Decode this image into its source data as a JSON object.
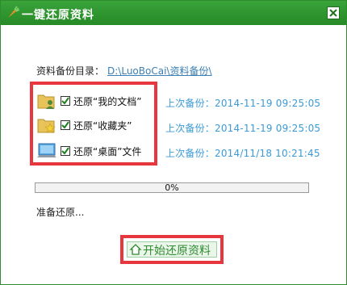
{
  "window": {
    "title": "一键还原资料",
    "close_icon": "close-icon",
    "accent": "#2e8b2e"
  },
  "backup_dir": {
    "label": "资料备份目录：",
    "path": "D:\\LuoBoCai\\资料备份\\"
  },
  "items": [
    {
      "label": "还原“我的文档”",
      "checked": true,
      "icon": "user-folder-icon",
      "last_backup": "上次备份：2014-11-19 09:25:05"
    },
    {
      "label": "还原“收藏夹”",
      "checked": true,
      "icon": "favorites-folder-icon",
      "last_backup": "上次备份：2014-11-19 09:25:05"
    },
    {
      "label": "还原“桌面”文件",
      "checked": true,
      "icon": "desktop-icon",
      "last_backup": "上次备份：2014/11/18 10:21:45"
    }
  ],
  "progress": {
    "value": 0,
    "text": "0%"
  },
  "status": "准备还原...",
  "start_button": {
    "label": "开始还原资料",
    "icon": "house-icon"
  },
  "colors": {
    "highlight_border": "#e8363e",
    "link": "#3b7fb5",
    "last_backup_text": "#3b9ad6"
  }
}
